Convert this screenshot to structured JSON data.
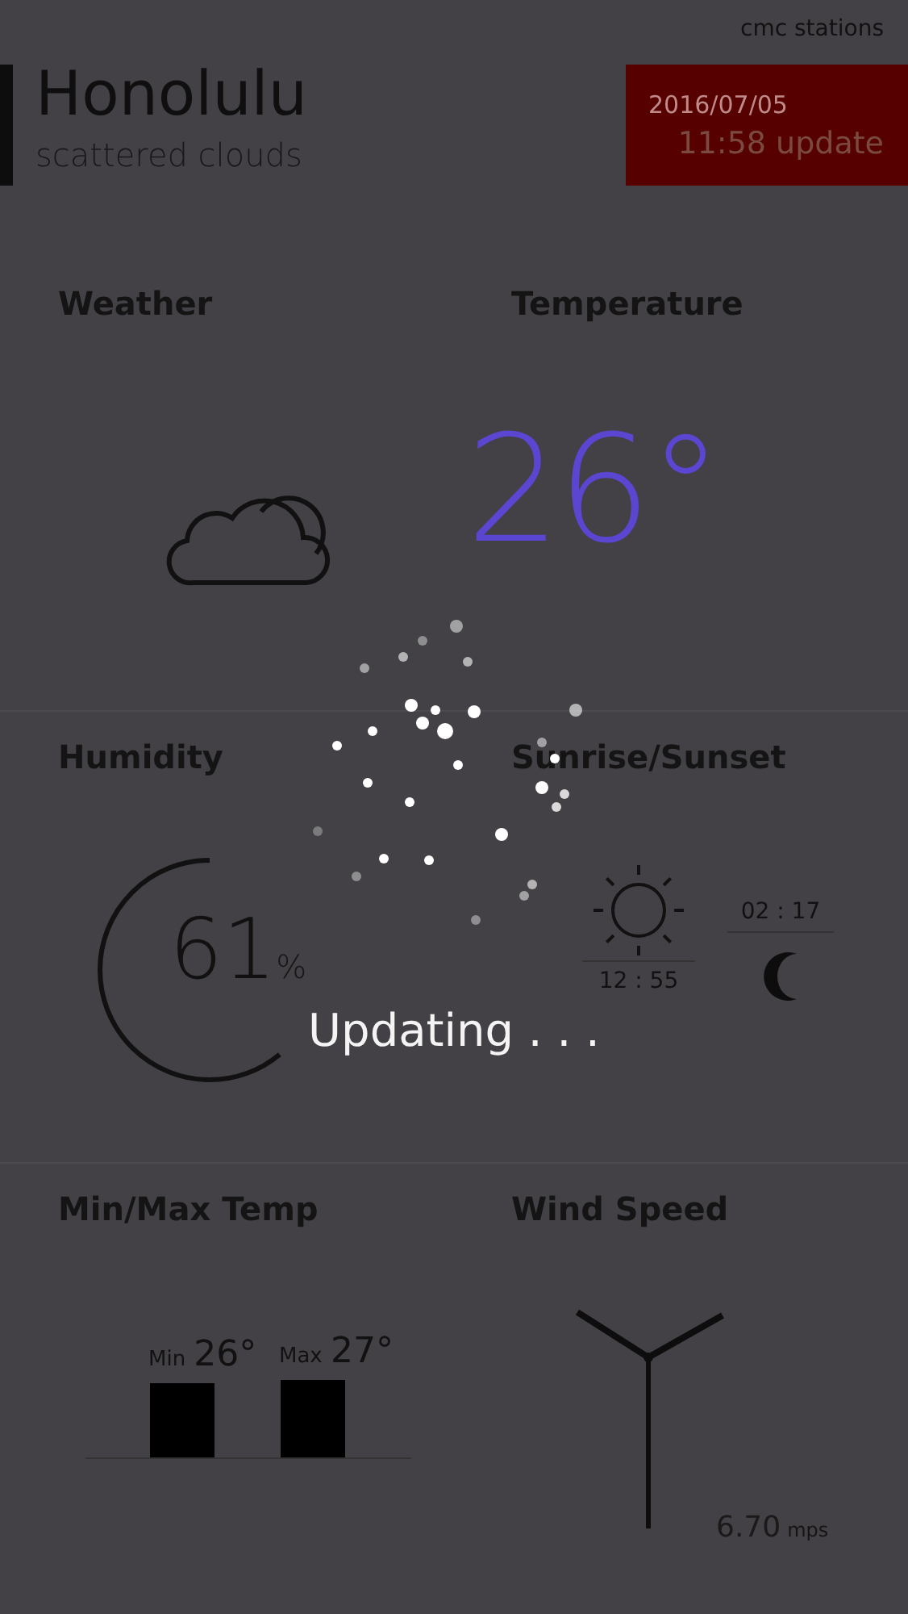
{
  "header": {
    "source": "cmc stations",
    "city": "Honolulu",
    "condition": "scattered clouds",
    "date": "2016/07/05",
    "update": "11:58 update"
  },
  "tiles": [
    {
      "kind": "weather",
      "title": "Weather"
    },
    {
      "kind": "temperature",
      "title": "Temperature",
      "value": "26°"
    },
    {
      "kind": "humidity",
      "title": "Humidity",
      "value": "61",
      "unit": "%",
      "level": 0.61
    },
    {
      "kind": "sun",
      "title": "Sunrise/Sunset",
      "sunrise": "12 : 55",
      "sunset": "02 : 17"
    },
    {
      "kind": "minmax",
      "title": "Min/Max Temp",
      "min_label": "Min",
      "min": "26°",
      "max_label": "Max",
      "max": "27°"
    },
    {
      "kind": "wind",
      "title": "Wind Speed",
      "value": "6.70",
      "unit": "mps"
    }
  ],
  "overlay": {
    "message": "Updating . . ."
  }
}
